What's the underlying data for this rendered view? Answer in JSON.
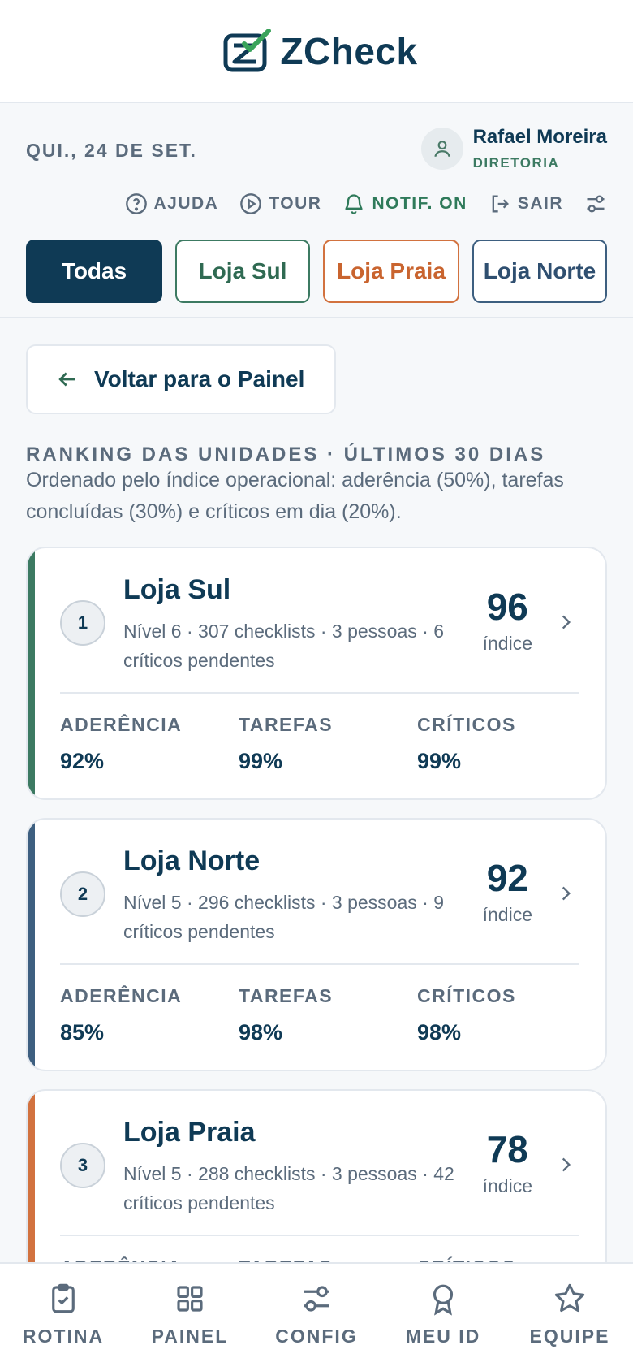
{
  "app": {
    "name": "ZCheck"
  },
  "header": {
    "date": "QUI., 24 DE SET.",
    "user": {
      "name": "Rafael Moreira",
      "role": "DIRETORIA"
    },
    "actions": {
      "help": "AJUDA",
      "tour": "TOUR",
      "notif": "NOTIF. ON",
      "logout": "SAIR"
    },
    "filters": [
      "Todas",
      "Loja Sul",
      "Loja Praia",
      "Loja Norte"
    ]
  },
  "back_label": "Voltar para o Painel",
  "ranking": {
    "title": "RANKING DAS UNIDADES · ÚLTIMOS 30 DIAS",
    "description": "Ordenado pelo índice operacional: aderência (50%), tarefas concluídas (30%) e críticos em dia (20%).",
    "metric_labels": {
      "adherence": "ADERÊNCIA",
      "tasks": "TAREFAS",
      "critical": "CRÍTICOS"
    },
    "score_label": "índice",
    "stores": [
      {
        "rank": "1",
        "name": "Loja Sul",
        "meta": "Nível 6 · 307 checklists · 3 pessoas · 6 críticos pendentes",
        "score": "96",
        "adherence": "92%",
        "tasks": "99%",
        "critical": "99%",
        "color": "#3c7a62"
      },
      {
        "rank": "2",
        "name": "Loja Norte",
        "meta": "Nível 5 · 296 checklists · 3 pessoas · 9 críticos pendentes",
        "score": "92",
        "adherence": "85%",
        "tasks": "98%",
        "critical": "98%",
        "color": "#3d5f80"
      },
      {
        "rank": "3",
        "name": "Loja Praia",
        "meta": "Nível 5 · 288 checklists · 3 pessoas · 42 críticos pendentes",
        "score": "78",
        "adherence": "",
        "tasks": "",
        "critical": "",
        "color": "#d2723f"
      }
    ]
  },
  "nav": [
    "ROTINA",
    "PAINEL",
    "CONFIG",
    "MEU ID",
    "EQUIPE"
  ]
}
